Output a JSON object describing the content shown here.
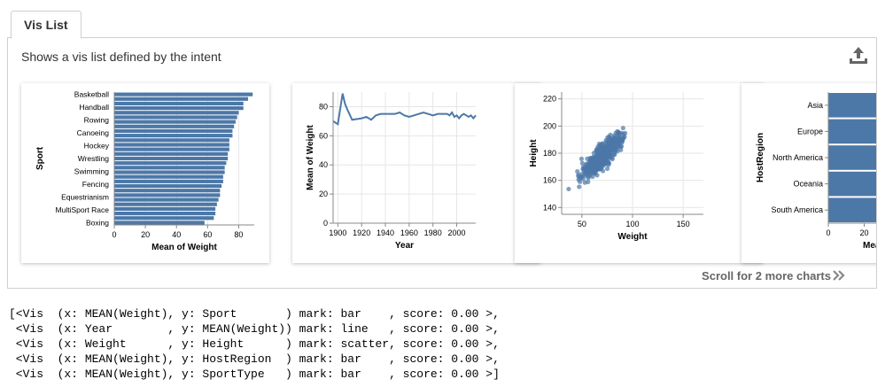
{
  "tab": {
    "label": "Vis List"
  },
  "subtitle": "Shows a vis list defined by the intent",
  "export_icon": "export-upload-icon",
  "scroll_hint": "Scroll for 2 more charts",
  "scroll_icon": "double-chevron-right-icon",
  "accent_color": "#4c78a8",
  "chart_data": [
    {
      "type": "bar",
      "orientation": "horizontal",
      "categories": [
        "Basketball",
        "Handball",
        "Rowing",
        "Canoeing",
        "Hockey",
        "Wrestling",
        "Swimming",
        "Fencing",
        "Equestrianism",
        "MultiSport Race",
        "Boxing"
      ],
      "all_bar_values": [
        89,
        86,
        83,
        83,
        80,
        79,
        78,
        77,
        76,
        76,
        74,
        74,
        74,
        73,
        73,
        72,
        71,
        71,
        70,
        70,
        69,
        68,
        68,
        67,
        66,
        65,
        65,
        64,
        58
      ],
      "xlabel": "Mean of Weight",
      "ylabel": "Sport",
      "x_ticks": [
        "0",
        "20",
        "40",
        "60",
        "80"
      ],
      "xlim": [
        0,
        90
      ]
    },
    {
      "type": "line",
      "x": [
        1896,
        1900,
        1904,
        1906,
        1908,
        1912,
        1920,
        1924,
        1928,
        1932,
        1936,
        1948,
        1952,
        1956,
        1960,
        1964,
        1968,
        1972,
        1976,
        1980,
        1984,
        1988,
        1992,
        1994,
        1996,
        1998,
        2000,
        2002,
        2004,
        2006,
        2008,
        2010,
        2012,
        2014,
        2016
      ],
      "y": [
        70,
        68,
        89,
        82,
        78,
        71,
        72,
        73,
        71,
        74,
        75,
        75,
        76,
        74,
        73,
        74,
        75,
        76,
        75,
        74,
        75,
        75,
        75,
        74,
        76,
        73,
        74,
        72,
        74,
        75,
        74,
        73,
        74,
        72,
        74
      ],
      "xlabel": "Year",
      "ylabel": "Mean of Weight",
      "x_ticks": [
        "1900",
        "1920",
        "1940",
        "1960",
        "1980",
        "2000"
      ],
      "y_ticks": [
        "0",
        "20",
        "40",
        "60",
        "80"
      ],
      "xlim": [
        1896,
        2016
      ],
      "ylim": [
        0,
        90
      ]
    },
    {
      "type": "scatter",
      "xlabel": "Weight",
      "ylabel": "Height",
      "x_ticks": [
        "50",
        "100",
        "150"
      ],
      "y_ticks": [
        "140",
        "160",
        "180",
        "200",
        "220"
      ],
      "xlim": [
        30,
        170
      ],
      "ylim": [
        135,
        225
      ]
    },
    {
      "type": "bar",
      "orientation": "horizontal",
      "categories": [
        "Asia",
        "Europe",
        "North America",
        "Oceania",
        "South America"
      ],
      "values": [
        72,
        72,
        73,
        72,
        71
      ],
      "xlabel": "Mea",
      "ylabel": "HostRegion",
      "x_ticks": [
        "0",
        "20"
      ],
      "xlim": [
        0,
        80
      ]
    }
  ],
  "repr_lines": [
    "[<Vis  (x: MEAN(Weight), y: Sport       ) mark: bar    , score: 0.00 >,",
    " <Vis  (x: Year        , y: MEAN(Weight)) mark: line   , score: 0.00 >,",
    " <Vis  (x: Weight      , y: Height      ) mark: scatter, score: 0.00 >,",
    " <Vis  (x: MEAN(Weight), y: HostRegion  ) mark: bar    , score: 0.00 >,",
    " <Vis  (x: MEAN(Weight), y: SportType   ) mark: bar    , score: 0.00 >]"
  ]
}
